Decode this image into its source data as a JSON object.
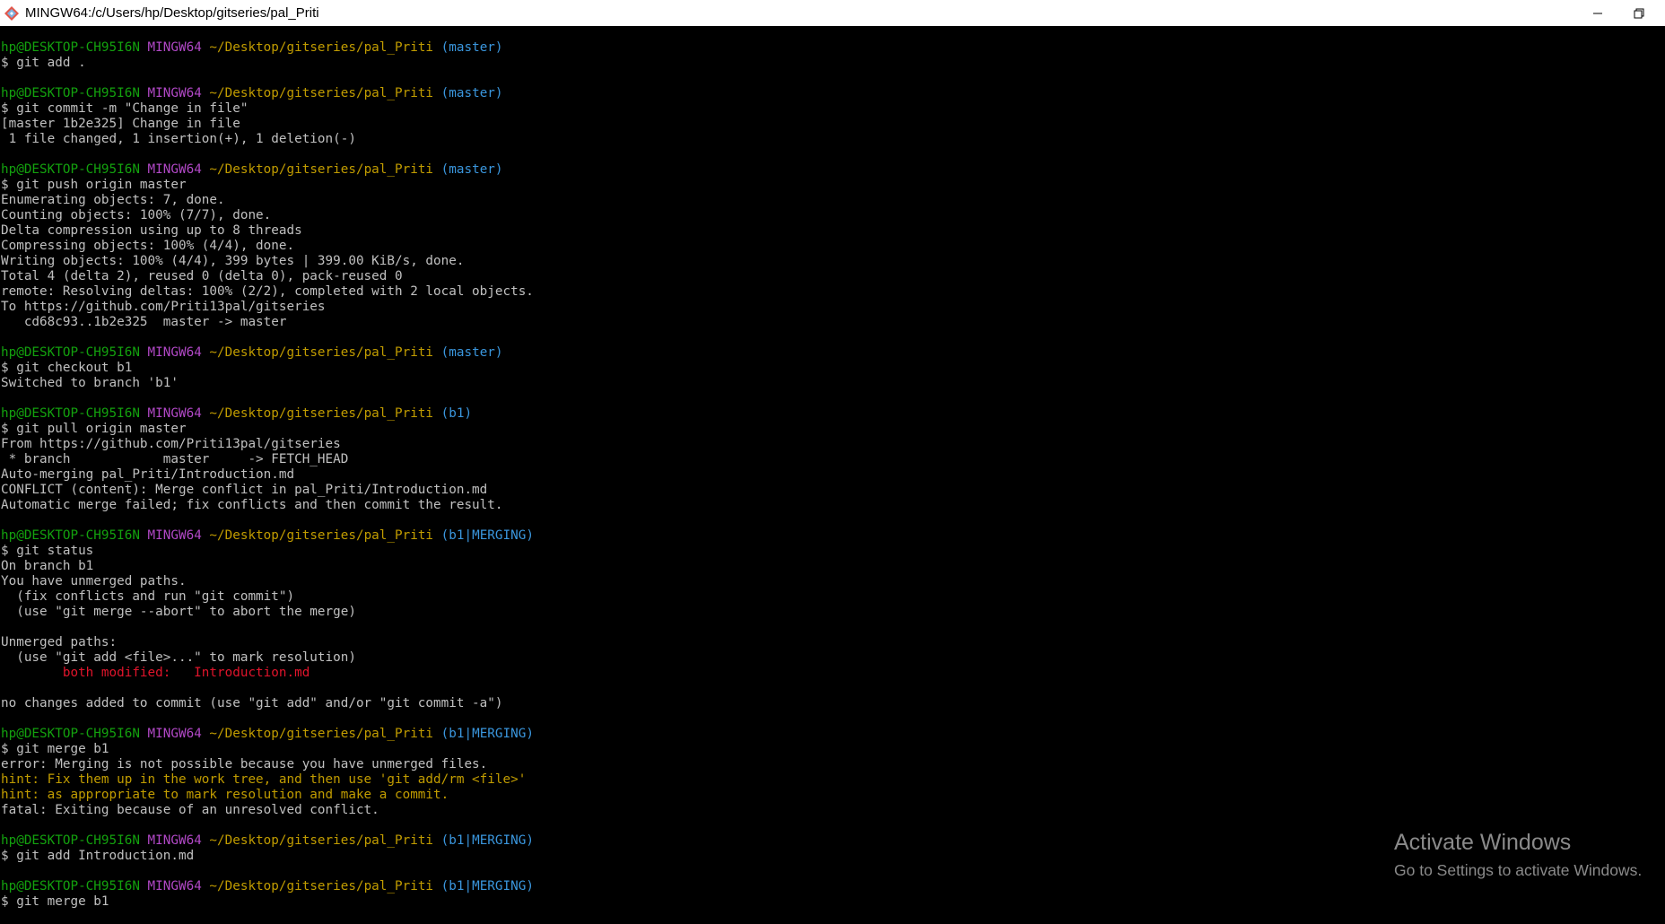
{
  "window": {
    "title": "MINGW64:/c/Users/hp/Desktop/gitseries/pal_Priti",
    "icons": {
      "app": "git-bash-icon",
      "minimize": "minimize-icon",
      "maximize": "restore-icon"
    }
  },
  "colors": {
    "background": "#000000",
    "text": "#c0c0c0",
    "user": "#13a10e",
    "host": "#b148c6",
    "path": "#c19c00",
    "branch": "#3a96dd",
    "error": "#e0142b",
    "hint": "#c19c00"
  },
  "terminal": {
    "lines": [
      {
        "kind": "prompt",
        "user": "hp@DESKTOP-CH95I6N",
        "host": "MINGW64",
        "path": "~/Desktop/gitseries/pal_Priti",
        "branch": "(master)"
      },
      {
        "kind": "text",
        "text": "$ git add ."
      },
      {
        "kind": "blank"
      },
      {
        "kind": "prompt",
        "user": "hp@DESKTOP-CH95I6N",
        "host": "MINGW64",
        "path": "~/Desktop/gitseries/pal_Priti",
        "branch": "(master)"
      },
      {
        "kind": "text",
        "text": "$ git commit -m \"Change in file\""
      },
      {
        "kind": "text",
        "text": "[master 1b2e325] Change in file"
      },
      {
        "kind": "text",
        "text": " 1 file changed, 1 insertion(+), 1 deletion(-)"
      },
      {
        "kind": "blank"
      },
      {
        "kind": "prompt",
        "user": "hp@DESKTOP-CH95I6N",
        "host": "MINGW64",
        "path": "~/Desktop/gitseries/pal_Priti",
        "branch": "(master)"
      },
      {
        "kind": "text",
        "text": "$ git push origin master"
      },
      {
        "kind": "text",
        "text": "Enumerating objects: 7, done."
      },
      {
        "kind": "text",
        "text": "Counting objects: 100% (7/7), done."
      },
      {
        "kind": "text",
        "text": "Delta compression using up to 8 threads"
      },
      {
        "kind": "text",
        "text": "Compressing objects: 100% (4/4), done."
      },
      {
        "kind": "text",
        "text": "Writing objects: 100% (4/4), 399 bytes | 399.00 KiB/s, done."
      },
      {
        "kind": "text",
        "text": "Total 4 (delta 2), reused 0 (delta 0), pack-reused 0"
      },
      {
        "kind": "text",
        "text": "remote: Resolving deltas: 100% (2/2), completed with 2 local objects."
      },
      {
        "kind": "text",
        "text": "To https://github.com/Priti13pal/gitseries"
      },
      {
        "kind": "text",
        "text": "   cd68c93..1b2e325  master -> master"
      },
      {
        "kind": "blank"
      },
      {
        "kind": "prompt",
        "user": "hp@DESKTOP-CH95I6N",
        "host": "MINGW64",
        "path": "~/Desktop/gitseries/pal_Priti",
        "branch": "(master)"
      },
      {
        "kind": "text",
        "text": "$ git checkout b1"
      },
      {
        "kind": "text",
        "text": "Switched to branch 'b1'"
      },
      {
        "kind": "blank"
      },
      {
        "kind": "prompt",
        "user": "hp@DESKTOP-CH95I6N",
        "host": "MINGW64",
        "path": "~/Desktop/gitseries/pal_Priti",
        "branch": "(b1)"
      },
      {
        "kind": "text",
        "text": "$ git pull origin master"
      },
      {
        "kind": "text",
        "text": "From https://github.com/Priti13pal/gitseries"
      },
      {
        "kind": "text",
        "text": " * branch            master     -> FETCH_HEAD"
      },
      {
        "kind": "text",
        "text": "Auto-merging pal_Priti/Introduction.md"
      },
      {
        "kind": "text",
        "text": "CONFLICT (content): Merge conflict in pal_Priti/Introduction.md"
      },
      {
        "kind": "text",
        "text": "Automatic merge failed; fix conflicts and then commit the result."
      },
      {
        "kind": "blank"
      },
      {
        "kind": "prompt",
        "user": "hp@DESKTOP-CH95I6N",
        "host": "MINGW64",
        "path": "~/Desktop/gitseries/pal_Priti",
        "branch": "(b1|MERGING)"
      },
      {
        "kind": "text",
        "text": "$ git status"
      },
      {
        "kind": "text",
        "text": "On branch b1"
      },
      {
        "kind": "text",
        "text": "You have unmerged paths."
      },
      {
        "kind": "text",
        "text": "  (fix conflicts and run \"git commit\")"
      },
      {
        "kind": "text",
        "text": "  (use \"git merge --abort\" to abort the merge)"
      },
      {
        "kind": "blank"
      },
      {
        "kind": "text",
        "text": "Unmerged paths:"
      },
      {
        "kind": "text",
        "text": "  (use \"git add <file>...\" to mark resolution)"
      },
      {
        "kind": "error",
        "text": "        both modified:   Introduction.md"
      },
      {
        "kind": "blank"
      },
      {
        "kind": "text",
        "text": "no changes added to commit (use \"git add\" and/or \"git commit -a\")"
      },
      {
        "kind": "blank"
      },
      {
        "kind": "prompt",
        "user": "hp@DESKTOP-CH95I6N",
        "host": "MINGW64",
        "path": "~/Desktop/gitseries/pal_Priti",
        "branch": "(b1|MERGING)"
      },
      {
        "kind": "text",
        "text": "$ git merge b1"
      },
      {
        "kind": "text",
        "text": "error: Merging is not possible because you have unmerged files."
      },
      {
        "kind": "hint",
        "text": "hint: Fix them up in the work tree, and then use 'git add/rm <file>'"
      },
      {
        "kind": "hint",
        "text": "hint: as appropriate to mark resolution and make a commit."
      },
      {
        "kind": "text",
        "text": "fatal: Exiting because of an unresolved conflict."
      },
      {
        "kind": "blank"
      },
      {
        "kind": "prompt",
        "user": "hp@DESKTOP-CH95I6N",
        "host": "MINGW64",
        "path": "~/Desktop/gitseries/pal_Priti",
        "branch": "(b1|MERGING)"
      },
      {
        "kind": "text",
        "text": "$ git add Introduction.md"
      },
      {
        "kind": "blank"
      },
      {
        "kind": "prompt",
        "user": "hp@DESKTOP-CH95I6N",
        "host": "MINGW64",
        "path": "~/Desktop/gitseries/pal_Priti",
        "branch": "(b1|MERGING)"
      },
      {
        "kind": "text",
        "text": "$ git merge b1"
      }
    ]
  },
  "watermark": {
    "title": "Activate Windows",
    "subtitle": "Go to Settings to activate Windows."
  }
}
